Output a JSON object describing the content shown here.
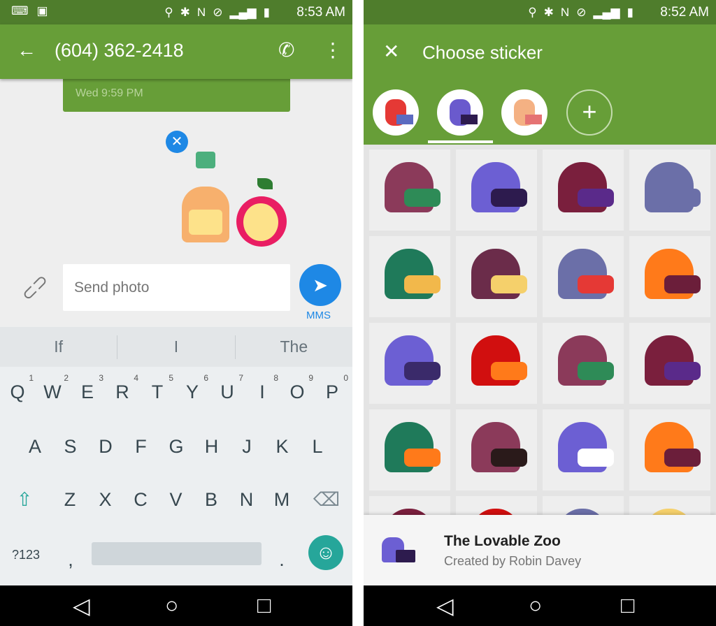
{
  "left": {
    "status": {
      "time": "8:53 AM",
      "left_icons": [
        "keyboard-icon",
        "image-icon"
      ],
      "right_icons": [
        "location-icon",
        "bluetooth-icon",
        "nfc-icon",
        "do-not-disturb-icon",
        "lte-icon",
        "signal-icon",
        "battery-icon"
      ]
    },
    "toolbar": {
      "title": "(604) 362-2418"
    },
    "message": {
      "timestamp": "Wed 9:59 PM"
    },
    "compose": {
      "placeholder": "Send photo",
      "send_label": "MMS"
    },
    "suggestions": [
      "If",
      "I",
      "The"
    ],
    "keyboard": {
      "row1": [
        [
          "Q",
          "1"
        ],
        [
          "W",
          "2"
        ],
        [
          "E",
          "3"
        ],
        [
          "R",
          "4"
        ],
        [
          "T",
          "5"
        ],
        [
          "Y",
          "6"
        ],
        [
          "U",
          "7"
        ],
        [
          "I",
          "8"
        ],
        [
          "O",
          "9"
        ],
        [
          "P",
          "0"
        ]
      ],
      "row2": [
        "A",
        "S",
        "D",
        "F",
        "G",
        "H",
        "J",
        "K",
        "L"
      ],
      "row3": [
        "Z",
        "X",
        "C",
        "V",
        "B",
        "N",
        "M"
      ],
      "symbols": "?123",
      "comma": ",",
      "period": "."
    }
  },
  "right": {
    "status": {
      "time": "8:52 AM"
    },
    "toolbar": {
      "title": "Choose sticker"
    },
    "tabs": [
      {
        "name": "pack-tab-1",
        "colors": [
          "#e53935",
          "#5c6bc0"
        ]
      },
      {
        "name": "pack-tab-lovable-zoo",
        "colors": [
          "#6a5acd",
          "#2d1b4e"
        ],
        "selected": true
      },
      {
        "name": "pack-tab-toast",
        "colors": [
          "#f4b183",
          "#e57373"
        ]
      }
    ],
    "stickers": [
      [
        "#8b3a5a",
        "#2e8b57"
      ],
      [
        "#6c5fd3",
        "#2d1b4e"
      ],
      [
        "#7a1f3d",
        "#5a2a8a"
      ],
      [
        "#6b6fa8",
        "#6b6fa8"
      ],
      [
        "#1f7a5a",
        "#f2b84b"
      ],
      [
        "#6b2c4a",
        "#f5d06b"
      ],
      [
        "#6b6fa8",
        "#e53935"
      ],
      [
        "#ff7a1a",
        "#6b1e3a"
      ],
      [
        "#6c5fd3",
        "#3a2a6a"
      ],
      [
        "#d10f0f",
        "#ff7a1a"
      ],
      [
        "#8b3a5a",
        "#2e8b57"
      ],
      [
        "#7a1f3d",
        "#5a2a8a"
      ],
      [
        "#1f7a5a",
        "#ff7a1a"
      ],
      [
        "#8b3a5a",
        "#2a1a1a"
      ],
      [
        "#6c5fd3",
        "#ffffff"
      ],
      [
        "#ff7a1a",
        "#6b1e3a"
      ],
      [
        "#7a1f3d",
        "#7a1f3d"
      ],
      [
        "#d10f0f",
        "#ff4a1a"
      ],
      [
        "#6b6fa8",
        "#6b6fa8"
      ],
      [
        "#f5d06b",
        "#f5d06b"
      ]
    ],
    "pack": {
      "title": "The Lovable Zoo",
      "author": "Created by Robin Davey"
    }
  },
  "colors": {
    "toolbar": "#679e38",
    "status": "#4f7d2c",
    "accent": "#1e88e5",
    "emoji": "#26a69a"
  }
}
